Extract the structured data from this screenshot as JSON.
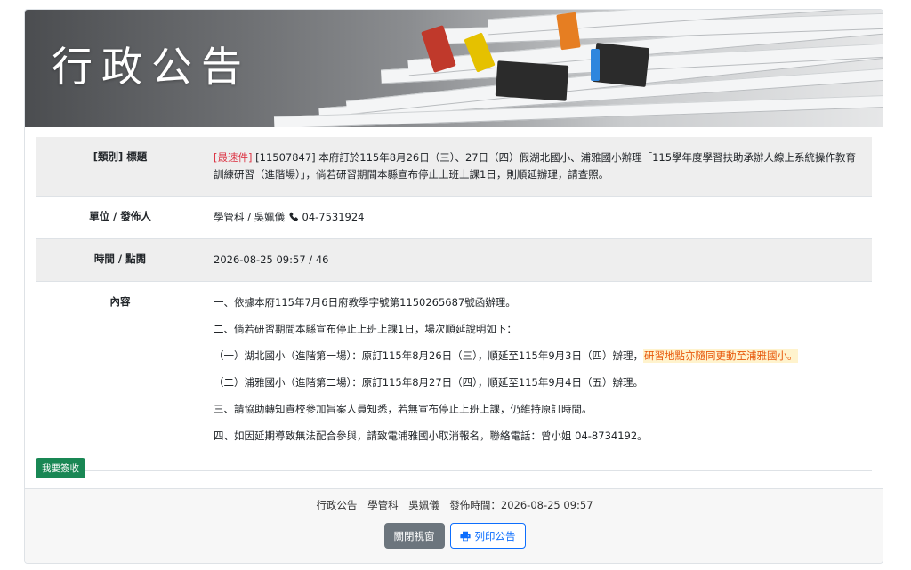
{
  "banner": {
    "title": "行政公告"
  },
  "rows": {
    "subject": {
      "label": "[類別] 標題",
      "category": "[最速件]",
      "text": " [11507847] 本府訂於115年8月26日（三）、27日（四）假湖北國小、浦雅國小辦理「115學年度學習扶助承辦人線上系統操作教育訓練研習（進階場）」，倘若研習期間本縣宣布停止上班上課1日，則順延辦理，請查照。"
    },
    "unit": {
      "label": "單位 / 發佈人",
      "value": "學管科 / 吳姵儀",
      "phone": "04-7531924"
    },
    "time": {
      "label": "時間 / 點閱",
      "value": "2026-08-25 09:57 / 46"
    },
    "content": {
      "label": "內容",
      "p1": "一、依據本府115年7月6日府教學字號第1150265687號函辦理。",
      "p2": "二、倘若研習期間本縣宣布停止上班上課1日，場次順延說明如下：",
      "p3": "（一）湖北國小（進階第一場）：原訂115年8月26日（三），順延至115年9月3日（四）辦理，",
      "p3_highlight": "研習地點亦隨同更動至浦雅國小。",
      "p4": "（二）浦雅國小（進階第二場）：原訂115年8月27日（四），順延至115年9月4日（五）辦理。",
      "p5": "三、請協助轉知貴校參加旨案人員知悉，若無宣布停止上班上課，仍維持原訂時間。",
      "p6": "四、如因延期導致無法配合參與，請致電浦雅國小取消報名，聯絡電話：曾小姐 04-8734192。"
    }
  },
  "sign_button": "我要簽收",
  "footer": {
    "section": "行政公告",
    "unit": "學管科",
    "person": "吳姵儀",
    "publish": "發佈時間：2026-08-25 09:57",
    "close_label": "關閉視窗",
    "print_label": "列印公告"
  },
  "colors": {
    "urgent": "#dc3545",
    "sign": "#198754",
    "print": "#0d6efd",
    "highlight_text": "#e8590c"
  },
  "icons": {
    "phone": "phone-icon",
    "print": "printer-icon"
  }
}
